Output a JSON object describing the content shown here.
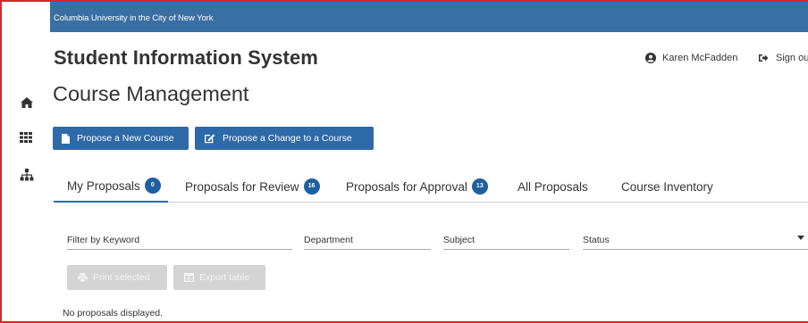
{
  "header": {
    "institution": "Columbia University in the City of New York",
    "app_title": "Student Information System",
    "user_name": "Karen McFadden",
    "signout_label": "Sign ou"
  },
  "sidebar": {
    "icons": [
      "home-icon",
      "grid-icon",
      "sitemap-icon"
    ]
  },
  "page": {
    "title": "Course Management"
  },
  "actions": {
    "propose_new": "Propose a New Course",
    "propose_change": "Propose a Change to a Course"
  },
  "tabs": [
    {
      "label": "My Proposals",
      "badge": "0",
      "active": true
    },
    {
      "label": "Proposals for Review",
      "badge": "16"
    },
    {
      "label": "Proposals for Approval",
      "badge": "13"
    },
    {
      "label": "All Proposals"
    },
    {
      "label": "Course Inventory"
    }
  ],
  "filters": {
    "keyword_placeholder": "Filter by Keyword",
    "department_placeholder": "Department",
    "subject_placeholder": "Subject",
    "status_placeholder": "Status"
  },
  "table_actions": {
    "print_label": "Print selected",
    "export_label": "Export table"
  },
  "empty_message": "No proposals displayed.",
  "colors": {
    "topbar": "#3a6fa3",
    "primary_button": "#2f6aa8",
    "badge": "#1f5fa0",
    "frame_border": "#d9252a",
    "disabled_button": "#d4d4d4"
  }
}
